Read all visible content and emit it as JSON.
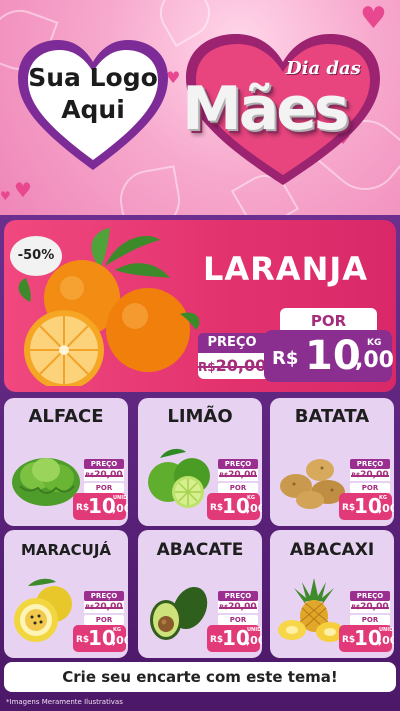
{
  "header": {
    "logo_text_line1": "Sua Logo",
    "logo_text_line2": "Aqui",
    "title_small": "Dia das",
    "title_big": "Mães"
  },
  "featured": {
    "discount_badge": "-50%",
    "name": "LARANJA",
    "old_label": "PREÇO",
    "old_currency": "R$",
    "old_value": "20,00",
    "new_label": "POR",
    "currency": "R$",
    "price_int": "10",
    "price_cents": ",00",
    "unit": "KG",
    "image_icon": "orange-fruit-icon"
  },
  "products": [
    {
      "name": "ALFACE",
      "preco_label": "PREÇO",
      "old_currency": "R$",
      "old_value": "20,00",
      "por_label": "POR",
      "currency": "R$",
      "price_int": "10",
      "price_cents": ",00",
      "unit": "UNID",
      "icon": "lettuce-icon"
    },
    {
      "name": "LIMÃO",
      "preco_label": "PREÇO",
      "old_currency": "R$",
      "old_value": "20,00",
      "por_label": "POR",
      "currency": "R$",
      "price_int": "10",
      "price_cents": ",00",
      "unit": "KG",
      "icon": "lime-icon"
    },
    {
      "name": "BATATA",
      "preco_label": "PREÇO",
      "old_currency": "R$",
      "old_value": "20,00",
      "por_label": "POR",
      "currency": "R$",
      "price_int": "10",
      "price_cents": ",00",
      "unit": "KG",
      "icon": "potato-icon"
    },
    {
      "name": "MARACUJÁ",
      "preco_label": "PREÇO",
      "old_currency": "R$",
      "old_value": "20,00",
      "por_label": "POR",
      "currency": "R$",
      "price_int": "10",
      "price_cents": ",00",
      "unit": "KG",
      "icon": "passion-fruit-icon"
    },
    {
      "name": "ABACATE",
      "preco_label": "PREÇO",
      "old_currency": "R$",
      "old_value": "20,00",
      "por_label": "POR",
      "currency": "R$",
      "price_int": "10",
      "price_cents": ",00",
      "unit": "UNID",
      "icon": "avocado-icon"
    },
    {
      "name": "ABACAXI",
      "preco_label": "PREÇO",
      "old_currency": "R$",
      "old_value": "20,00",
      "por_label": "POR",
      "currency": "R$",
      "price_int": "10",
      "price_cents": ",00",
      "unit": "UNID",
      "icon": "pineapple-icon"
    }
  ],
  "cta": "Crie seu encarte com este tema!",
  "footnote": "*Imagens Meramente Ilustrativas",
  "colors": {
    "accent_pink": "#e23a78",
    "accent_purple": "#8a2f90",
    "background": "#5b1f7a"
  }
}
